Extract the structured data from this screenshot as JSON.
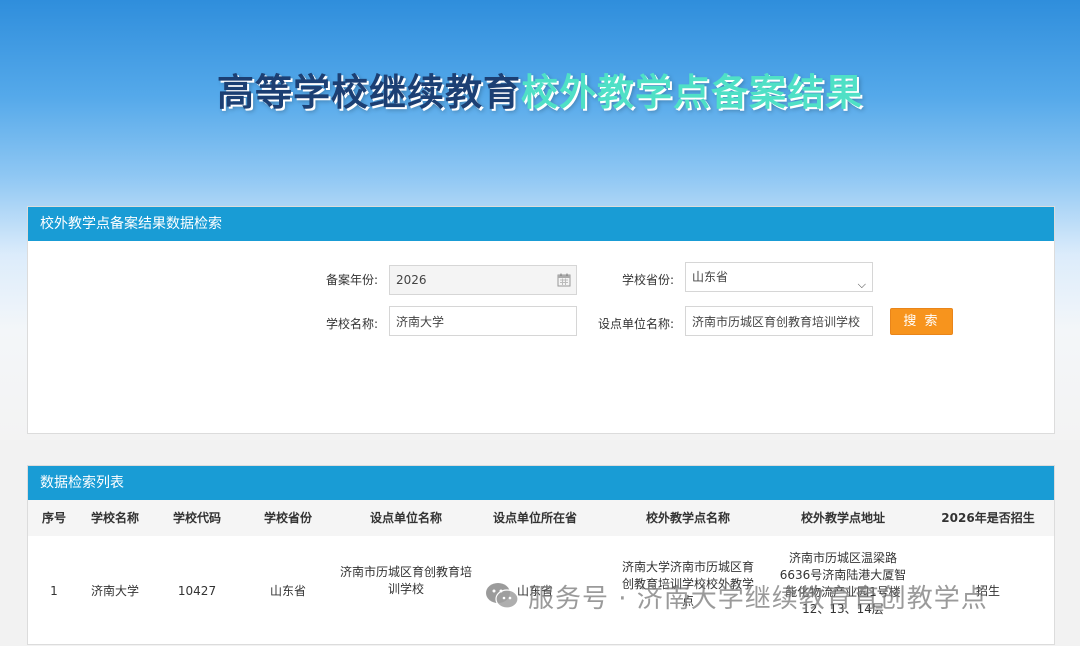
{
  "page": {
    "title_part1": "高等学校继续教育",
    "title_part2": "校外教学点备案结果"
  },
  "search": {
    "header": "校外教学点备案结果数据检索",
    "year_label": "备案年份:",
    "year_value": "2026",
    "province_label": "学校省份:",
    "province_value": "山东省",
    "school_label": "学校名称:",
    "school_value": "济南大学",
    "unit_label": "设点单位名称:",
    "unit_value": "济南市历城区育创教育培训学校",
    "button_label": "搜 索"
  },
  "list": {
    "header": "数据检索列表",
    "columns": [
      "序号",
      "学校名称",
      "学校代码",
      "学校省份",
      "设点单位名称",
      "设点单位所在省",
      "校外教学点名称",
      "校外教学点地址",
      "2026年是否招生"
    ],
    "rows": [
      {
        "index": "1",
        "school_name": "济南大学",
        "school_code": "10427",
        "school_province": "山东省",
        "unit_name": "济南市历城区育创教育培训学校",
        "unit_province": "山东省",
        "site_name": "济南大学济南市历城区育创教育培训学校校外教学点",
        "site_address": "济南市历城区温梁路6636号济南陆港大厦智能化物流产业园1号楼12、13、14层",
        "enrolling": "招生"
      }
    ]
  },
  "watermark": {
    "text": "服务号 · 济南大学继续教育育创教学点"
  }
}
